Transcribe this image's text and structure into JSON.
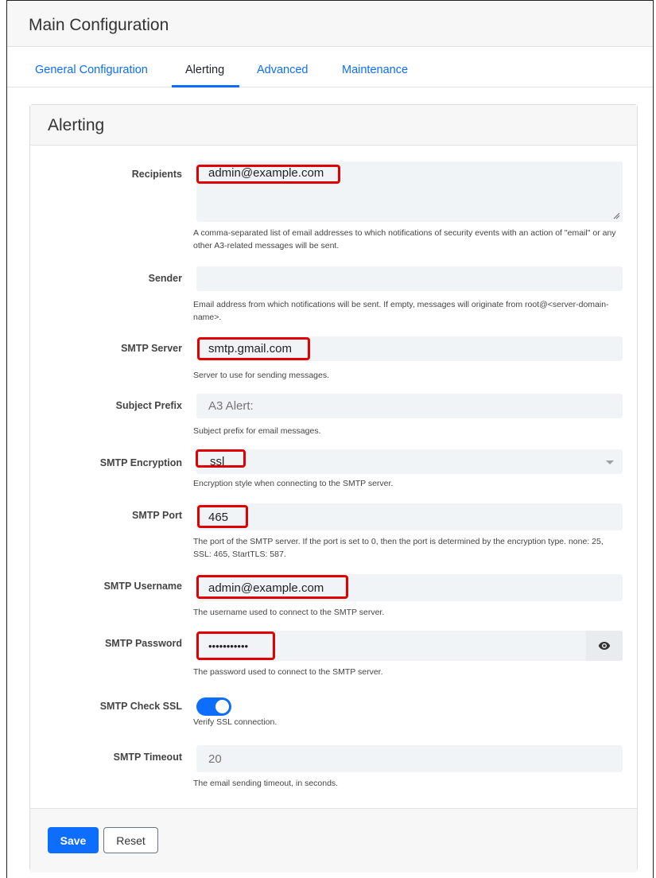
{
  "header": {
    "title": "Main Configuration"
  },
  "tabs": [
    {
      "label": "General Configuration",
      "active": false
    },
    {
      "label": "Alerting",
      "active": true
    },
    {
      "label": "Advanced",
      "active": false
    },
    {
      "label": "Maintenance",
      "active": false
    }
  ],
  "section": {
    "title": "Alerting"
  },
  "fields": {
    "recipients": {
      "label": "Recipients",
      "value": "admin@example.com",
      "help": "A comma-separated list of email addresses to which notifications of security events with an action of \"email\" or any other A3-related messages will be sent."
    },
    "sender": {
      "label": "Sender",
      "value": "",
      "help": "Email address from which notifications will be sent. If empty, messages will originate from root@<server-domain-name>."
    },
    "smtp_server": {
      "label": "SMTP Server",
      "value": "smtp.gmail.com",
      "help": "Server to use for sending messages."
    },
    "subject_prefix": {
      "label": "Subject Prefix",
      "placeholder": "A3 Alert:",
      "help": "Subject prefix for email messages."
    },
    "smtp_encryption": {
      "label": "SMTP Encryption",
      "value": "ssl",
      "help": "Encryption style when connecting to the SMTP server."
    },
    "smtp_port": {
      "label": "SMTP Port",
      "value": "465",
      "help": "The port of the SMTP server. If the port is set to 0, then the port is determined by the encryption type. none: 25, SSL: 465, StartTLS: 587."
    },
    "smtp_username": {
      "label": "SMTP Username",
      "value": "admin@example.com",
      "help": "The username used to connect to the SMTP server."
    },
    "smtp_password": {
      "label": "SMTP Password",
      "value": "•••••••••••",
      "help": "The password used to connect to the SMTP server."
    },
    "smtp_check_ssl": {
      "label": "SMTP Check SSL",
      "enabled": true,
      "help": "Verify SSL connection."
    },
    "smtp_timeout": {
      "label": "SMTP Timeout",
      "placeholder": "20",
      "help": "The email sending timeout, in seconds."
    }
  },
  "buttons": {
    "save": "Save",
    "reset": "Reset"
  },
  "icons": {
    "password_toggle": "eye-icon",
    "select_caret": "caret-down-icon"
  },
  "colors": {
    "accent": "#0d6efd",
    "highlight": "#e00000",
    "field_bg": "#f1f4f7"
  }
}
